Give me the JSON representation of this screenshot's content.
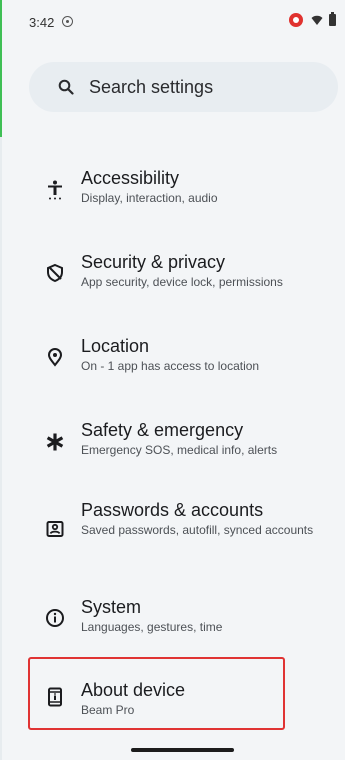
{
  "status_bar": {
    "time": "3:42",
    "icons": [
      "screen-record-icon",
      "notification-badge-icon",
      "wifi-icon",
      "battery-icon"
    ]
  },
  "search": {
    "placeholder": "Search settings",
    "icon": "search-icon"
  },
  "settings": [
    {
      "title": "Accessibility",
      "subtitle": "Display, interaction, audio",
      "icon": "accessibility-icon"
    },
    {
      "title": "Security & privacy",
      "subtitle": "App security, device lock, permissions",
      "icon": "shield-icon"
    },
    {
      "title": "Location",
      "subtitle": "On - 1 app has access to location",
      "icon": "location-pin-icon"
    },
    {
      "title": "Safety & emergency",
      "subtitle": "Emergency SOS, medical info, alerts",
      "icon": "asterisk-icon"
    },
    {
      "title": "Passwords & accounts",
      "subtitle": "Saved passwords, autofill, synced accounts",
      "icon": "account-box-icon"
    },
    {
      "title": "System",
      "subtitle": "Languages, gestures, time",
      "icon": "info-icon"
    },
    {
      "title": "About device",
      "subtitle": "Beam Pro",
      "icon": "device-info-icon"
    }
  ],
  "colors": {
    "background": "#f3f5f7",
    "search_bg": "#e8edf1",
    "highlight": "#e03333"
  }
}
